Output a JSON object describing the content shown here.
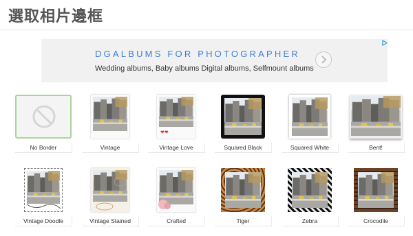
{
  "page": {
    "title": "選取相片邊框"
  },
  "ad": {
    "headline": "DGALBUMS FOR PHOTOGRAPHER",
    "description": "Wedding albums, Baby albums Digital albums, Selfmount albums"
  },
  "borders": [
    {
      "label": "No Border",
      "style": "none",
      "selected": true
    },
    {
      "label": "Vintage",
      "style": "vintage",
      "selected": false
    },
    {
      "label": "Vintage Love",
      "style": "vintage-love",
      "selected": false
    },
    {
      "label": "Squared Black",
      "style": "squared-black",
      "selected": false
    },
    {
      "label": "Squared White",
      "style": "squared-white",
      "selected": false
    },
    {
      "label": "Bent!",
      "style": "bent",
      "selected": false
    },
    {
      "label": "Vintage Doodle",
      "style": "vintage-doodle",
      "selected": false
    },
    {
      "label": "Vintage Stained",
      "style": "vintage-stained",
      "selected": false
    },
    {
      "label": "Crafted",
      "style": "crafted",
      "selected": false
    },
    {
      "label": "Tiger",
      "style": "tiger",
      "selected": false
    },
    {
      "label": "Zebra",
      "style": "zebra",
      "selected": false
    },
    {
      "label": "Crocodile",
      "style": "crocodile",
      "selected": false
    }
  ],
  "colors": {
    "selected_border": "#a9d49f",
    "ad_headline": "#3f7fd6"
  }
}
